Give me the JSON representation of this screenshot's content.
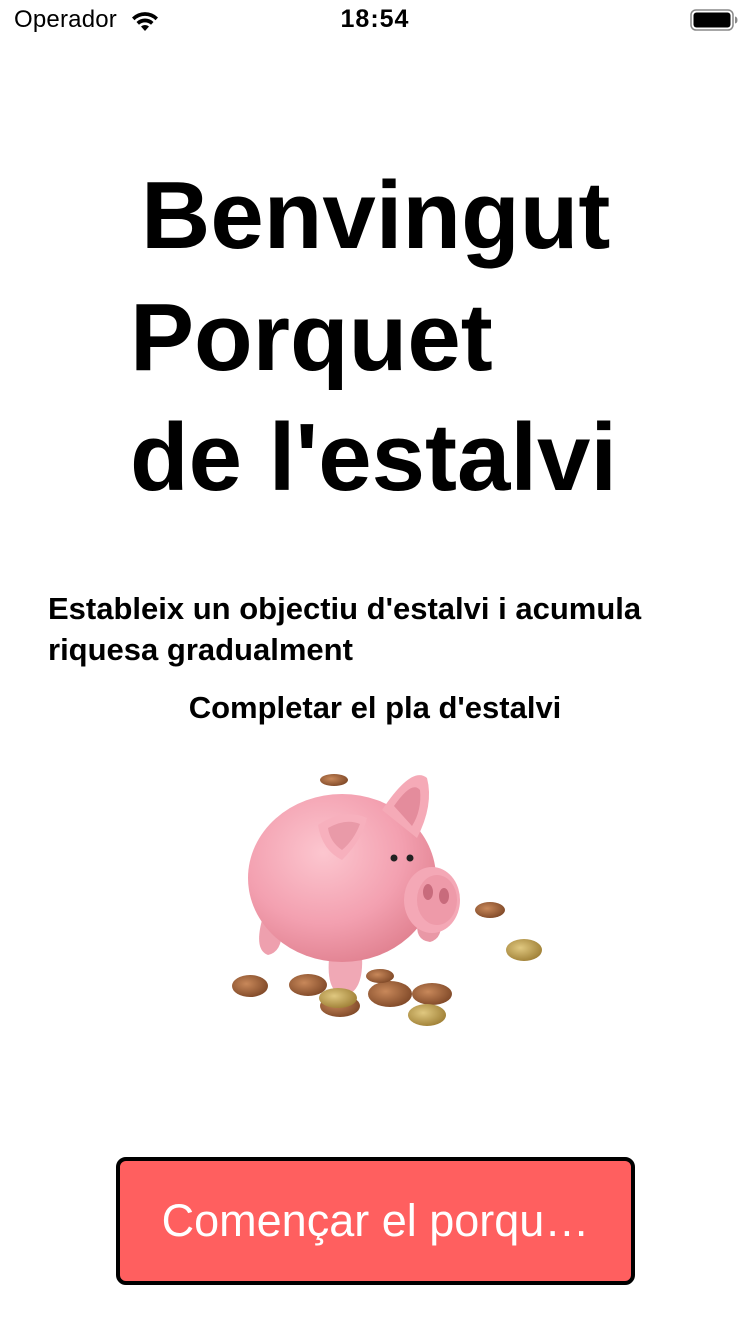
{
  "status_bar": {
    "carrier": "Operador",
    "time": "18:54",
    "wifi_icon": "wifi-icon",
    "battery_icon": "battery-icon"
  },
  "title": {
    "line1": "Benvingut",
    "line2": "Porquet",
    "line3": "de l'estalvi"
  },
  "subtitle": "Estableix un objectiu d'estalvi i acumula riquesa gradualment",
  "plan_label": "Completar el pla d'estalvi",
  "illustration": {
    "icon": "piggy-bank-illustration"
  },
  "start_button": {
    "label": "Començar el porqu…"
  },
  "colors": {
    "button_background": "#ff5f5f",
    "button_text": "#ffffff",
    "button_border": "#000000",
    "piggy_pink": "#f6a6b4"
  }
}
